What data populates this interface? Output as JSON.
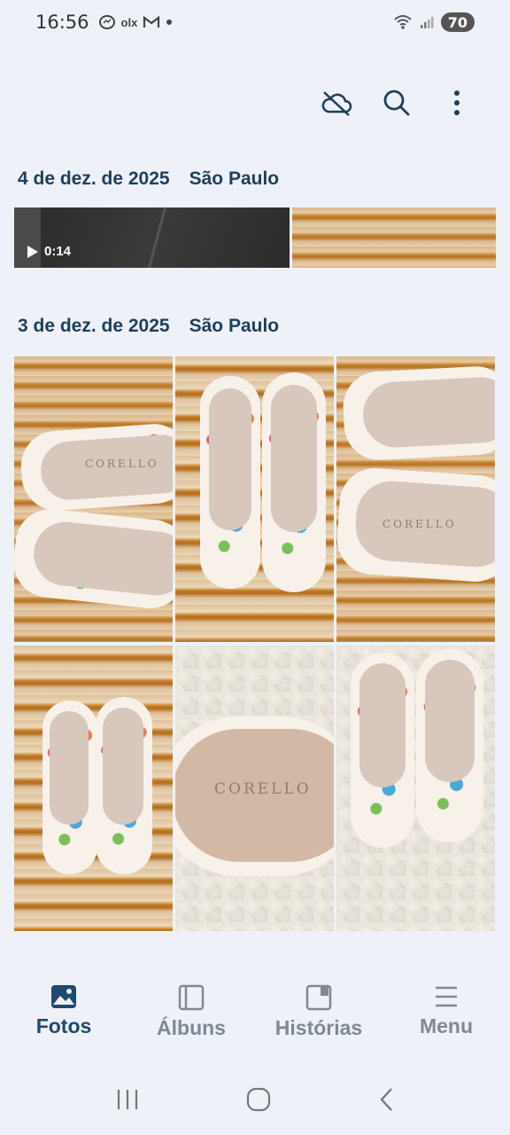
{
  "status_bar": {
    "time": "16:56",
    "notification_icons": [
      "messenger-icon",
      "olx-icon",
      "gmail-icon",
      "dot-icon"
    ],
    "olx_label": "olx",
    "battery": "70"
  },
  "toolbar": {
    "icons": [
      "cloud-off-icon",
      "search-icon",
      "more-vert-icon"
    ]
  },
  "sections": [
    {
      "date": "4 de dez. de 2025",
      "location": "São Paulo",
      "video_duration": "0:14"
    },
    {
      "date": "3 de dez. de 2025",
      "location": "São Paulo"
    }
  ],
  "photo_brand_text": "CORELLO",
  "bottom_nav": {
    "items": [
      {
        "label": "Fotos",
        "icon": "image-icon",
        "active": true
      },
      {
        "label": "Álbuns",
        "icon": "album-icon",
        "active": false
      },
      {
        "label": "Histórias",
        "icon": "stories-icon",
        "active": false
      },
      {
        "label": "Menu",
        "icon": "menu-icon",
        "active": false
      }
    ]
  },
  "colors": {
    "background": "#eef1f7",
    "accent": "#1e4a70",
    "inactive": "#7e8995"
  }
}
